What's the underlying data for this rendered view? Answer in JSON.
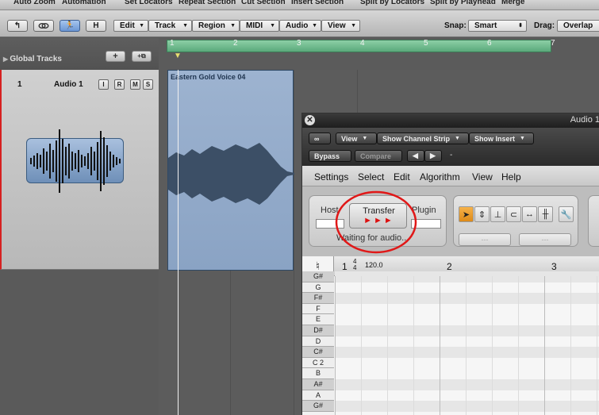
{
  "command_bar": {
    "items": [
      "Auto Zoom",
      "Automation",
      "Set Locators",
      "Repeat Section",
      "Cut Section",
      "Insert Section",
      "Split by Locators",
      "Split by Playhead",
      "Merge"
    ]
  },
  "toolbar": {
    "h_label": "H",
    "menus": [
      "Edit",
      "Track",
      "Region",
      "MIDI",
      "Audio",
      "View"
    ],
    "snap_label": "Snap:",
    "snap_value": "Smart",
    "drag_label": "Drag:",
    "drag_value": "Overlap"
  },
  "global_tracks": {
    "label": "Global Tracks",
    "add_label": "+"
  },
  "track": {
    "number": "1",
    "name": "Audio 1",
    "buttons": [
      "I",
      "R",
      "M",
      "S"
    ]
  },
  "ruler": {
    "bars": [
      "1",
      "2",
      "3",
      "4",
      "5",
      "6",
      "7"
    ]
  },
  "region": {
    "name": "Eastern Gold Voice 04"
  },
  "plugin": {
    "title": "Audio 1",
    "view_label": "View",
    "channel_strip_label": "Show Channel Strip",
    "insert_label": "Show Insert",
    "bypass_label": "Bypass",
    "compare_label": "Compare",
    "preset_value": "-",
    "menu": [
      "Settings",
      "Select",
      "Edit",
      "Algorithm",
      "View",
      "Help"
    ],
    "host_label": "Host",
    "transfer_label": "Transfer",
    "transfer_icon": "►►►",
    "plugin_label": "Plugin",
    "status_text": "Waiting for audio...",
    "dash_1": "---",
    "dash_2": "---",
    "timesig_top": "4",
    "timesig_bottom": "4",
    "bar_1": "1",
    "tempo": "120.0",
    "bar_2": "2",
    "bar_3": "3",
    "notes": [
      "G#",
      "G",
      "F#",
      "F",
      "E",
      "D#",
      "D",
      "C#",
      "C 2",
      "B",
      "A#",
      "A",
      "G#"
    ]
  },
  "colors": {
    "cycle_green": "#6fbf8e",
    "region_blue": "#8fa8c8",
    "transfer_circle": "#e01818",
    "track_select_red": "#d62020"
  }
}
